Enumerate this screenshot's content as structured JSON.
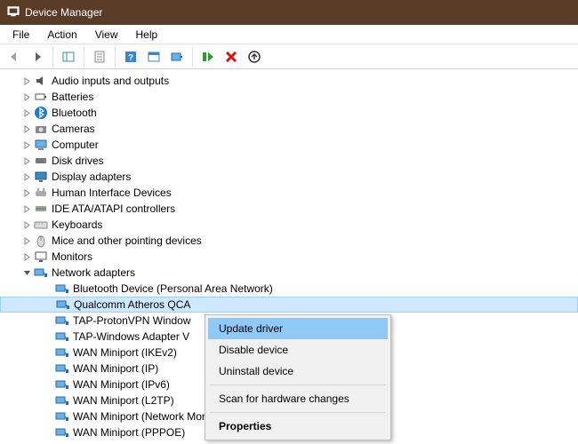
{
  "title": "Device Manager",
  "menu": [
    "File",
    "Action",
    "View",
    "Help"
  ],
  "toolbar": {
    "back": "back",
    "fwd": "forward",
    "showhide": "show-hide",
    "props": "properties",
    "help": "help",
    "ref": "refresh",
    "scan": "scan-for-hardware",
    "enable": "enable-device",
    "disable": "uninstall-device",
    "update": "update-driver"
  },
  "nodes": [
    {
      "level": 1,
      "exp": ">",
      "icon": "audio-icon",
      "label": "Audio inputs and outputs"
    },
    {
      "level": 1,
      "exp": ">",
      "icon": "battery-icon",
      "label": "Batteries"
    },
    {
      "level": 1,
      "exp": ">",
      "icon": "bluetooth-icon",
      "label": "Bluetooth"
    },
    {
      "level": 1,
      "exp": ">",
      "icon": "camera-icon",
      "label": "Cameras"
    },
    {
      "level": 1,
      "exp": ">",
      "icon": "computer-icon",
      "label": "Computer"
    },
    {
      "level": 1,
      "exp": ">",
      "icon": "disk-icon",
      "label": "Disk drives"
    },
    {
      "level": 1,
      "exp": ">",
      "icon": "display-icon",
      "label": "Display adapters"
    },
    {
      "level": 1,
      "exp": ">",
      "icon": "hid-icon",
      "label": "Human Interface Devices"
    },
    {
      "level": 1,
      "exp": ">",
      "icon": "ide-icon",
      "label": "IDE ATA/ATAPI controllers"
    },
    {
      "level": 1,
      "exp": ">",
      "icon": "keyboard-icon",
      "label": "Keyboards"
    },
    {
      "level": 1,
      "exp": ">",
      "icon": "mouse-icon",
      "label": "Mice and other pointing devices"
    },
    {
      "level": 1,
      "exp": ">",
      "icon": "monitor-icon",
      "label": "Monitors"
    },
    {
      "level": 1,
      "exp": "v",
      "icon": "network-icon",
      "label": "Network adapters"
    },
    {
      "level": 2,
      "exp": "",
      "icon": "network-icon",
      "label": "Bluetooth Device (Personal Area Network)"
    },
    {
      "level": 2,
      "exp": "",
      "icon": "network-icon",
      "label": "Qualcomm Atheros QCA",
      "sel": true
    },
    {
      "level": 2,
      "exp": "",
      "icon": "network-icon",
      "label": "TAP-ProtonVPN Window"
    },
    {
      "level": 2,
      "exp": "",
      "icon": "network-icon",
      "label": "TAP-Windows Adapter V"
    },
    {
      "level": 2,
      "exp": "",
      "icon": "network-icon",
      "label": "WAN Miniport (IKEv2)"
    },
    {
      "level": 2,
      "exp": "",
      "icon": "network-icon",
      "label": "WAN Miniport (IP)"
    },
    {
      "level": 2,
      "exp": "",
      "icon": "network-icon",
      "label": "WAN Miniport (IPv6)"
    },
    {
      "level": 2,
      "exp": "",
      "icon": "network-icon",
      "label": "WAN Miniport (L2TP)"
    },
    {
      "level": 2,
      "exp": "",
      "icon": "network-icon",
      "label": "WAN Miniport (Network Monitor)"
    },
    {
      "level": 2,
      "exp": "",
      "icon": "network-icon",
      "label": "WAN Miniport (PPPOE)"
    }
  ],
  "context": {
    "update": "Update driver",
    "disable": "Disable device",
    "uninstall": "Uninstall device",
    "scan": "Scan for hardware changes",
    "props": "Properties"
  }
}
